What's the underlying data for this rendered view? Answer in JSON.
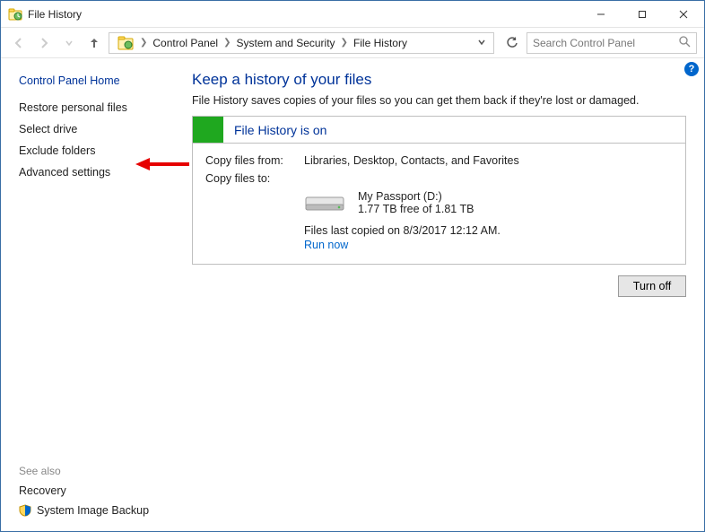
{
  "window": {
    "title": "File History"
  },
  "breadcrumbs": {
    "b0": "Control Panel",
    "b1": "System and Security",
    "b2": "File History"
  },
  "search": {
    "placeholder": "Search Control Panel"
  },
  "sidebar": {
    "home": "Control Panel Home",
    "links": {
      "l0": "Restore personal files",
      "l1": "Select drive",
      "l2": "Exclude folders",
      "l3": "Advanced settings"
    },
    "seealso_header": "See also",
    "seealso": {
      "s0": "Recovery",
      "s1": "System Image Backup"
    }
  },
  "main": {
    "heading": "Keep a history of your files",
    "subtext": "File History saves copies of your files so you can get them back if they're lost or damaged.",
    "panel_title": "File History is on",
    "copy_from_label": "Copy files from:",
    "copy_from_value": "Libraries, Desktop, Contacts, and Favorites",
    "copy_to_label": "Copy files to:",
    "drive_name": "My Passport (D:)",
    "drive_space": "1.77 TB free of 1.81 TB",
    "last_copied": "Files last copied on 8/3/2017 12:12 AM.",
    "run_now": "Run now",
    "turn_off": "Turn off"
  }
}
